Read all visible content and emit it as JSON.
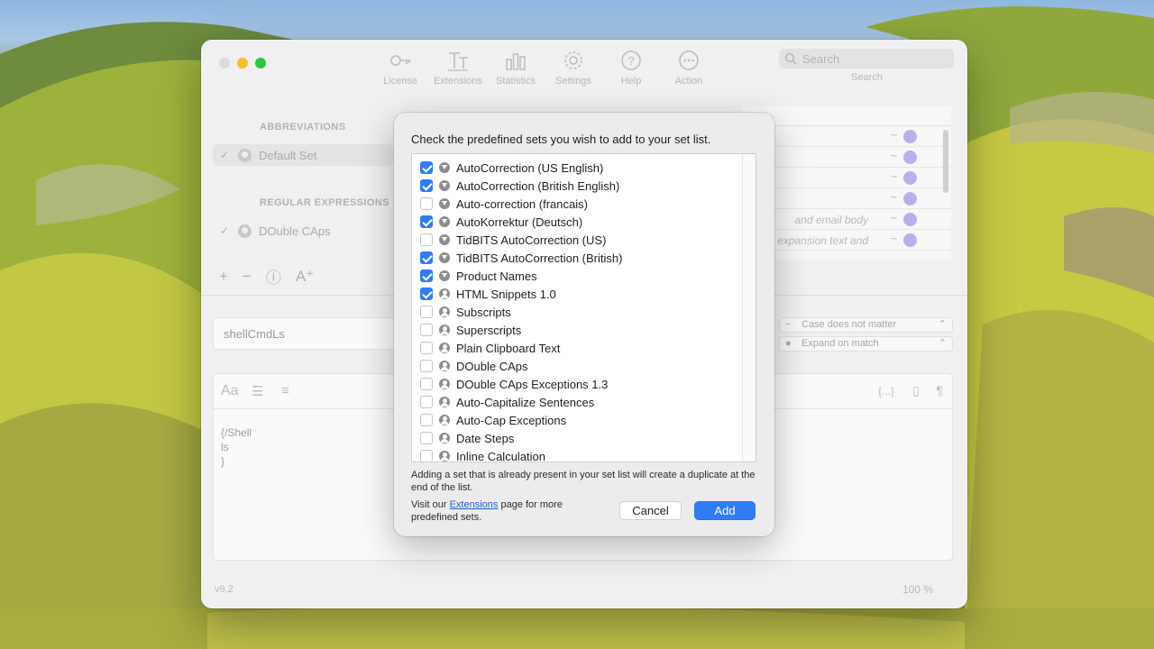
{
  "toolbar": {
    "items": [
      {
        "label": "License",
        "icon": "key-icon"
      },
      {
        "label": "Extensions",
        "icon": "extensions-icon"
      },
      {
        "label": "Statistics",
        "icon": "statistics-icon"
      },
      {
        "label": "Settings",
        "icon": "gear-icon"
      },
      {
        "label": "Help",
        "icon": "help-icon"
      },
      {
        "label": "Action",
        "icon": "ellipsis-icon"
      }
    ],
    "search_placeholder": "Search",
    "search_caption": "Search"
  },
  "sidebar": {
    "abbreviations_header": "ABBREVIATIONS",
    "regex_header": "REGULAR EXPRESSIONS",
    "default_set": "Default Set",
    "double_caps": "DOuble CAps"
  },
  "table": {
    "rows": [
      {
        "text": ""
      },
      {
        "text": ""
      },
      {
        "text": ""
      },
      {
        "text": ""
      },
      {
        "text": "and email body"
      },
      {
        "text": "ne expansion text and"
      }
    ]
  },
  "editor": {
    "abbreviation": "shellCmdLs",
    "case_option": "Case does not matter",
    "expand_option": "Expand on match",
    "content": "{/Shell\nls\n}",
    "tool_aa": "Aa",
    "tool_braces": "{...}",
    "tool_pilcrow": "¶"
  },
  "footer": {
    "version": "v9.2",
    "zoom": "100 %"
  },
  "modal": {
    "title": "Check the predefined sets you wish to add to your set list.",
    "sets": [
      {
        "name": "AutoCorrection (US English)",
        "checked": true,
        "icon": "download"
      },
      {
        "name": "AutoCorrection (British English)",
        "checked": true,
        "icon": "download"
      },
      {
        "name": "Auto-correction (francais)",
        "checked": false,
        "icon": "download"
      },
      {
        "name": "AutoKorrektur (Deutsch)",
        "checked": true,
        "icon": "download"
      },
      {
        "name": "TidBITS AutoCorrection (US)",
        "checked": false,
        "icon": "download"
      },
      {
        "name": "TidBITS AutoCorrection (British)",
        "checked": true,
        "icon": "download"
      },
      {
        "name": "Product Names",
        "checked": true,
        "icon": "download"
      },
      {
        "name": "HTML Snippets 1.0",
        "checked": true,
        "icon": "person"
      },
      {
        "name": "Subscripts",
        "checked": false,
        "icon": "person"
      },
      {
        "name": "Superscripts",
        "checked": false,
        "icon": "person"
      },
      {
        "name": "Plain Clipboard Text",
        "checked": false,
        "icon": "person"
      },
      {
        "name": "DOuble CAps",
        "checked": false,
        "icon": "person"
      },
      {
        "name": "DOuble CAps Exceptions 1.3",
        "checked": false,
        "icon": "person"
      },
      {
        "name": "Auto-Capitalize Sentences",
        "checked": false,
        "icon": "person"
      },
      {
        "name": "Auto-Cap Exceptions",
        "checked": false,
        "icon": "person"
      },
      {
        "name": "Date Steps",
        "checked": false,
        "icon": "person"
      },
      {
        "name": "Inline Calculation",
        "checked": false,
        "icon": "person"
      }
    ],
    "note": "Adding a set that is already present in your set list will create a duplicate at the end of the list.",
    "visit_prefix": "Visit our ",
    "visit_link": "Extensions",
    "visit_suffix": " page for more predefined sets.",
    "cancel_label": "Cancel",
    "add_label": "Add"
  },
  "colors": {
    "accent": "#2f7cf6",
    "badge": "#b7b0ea"
  }
}
